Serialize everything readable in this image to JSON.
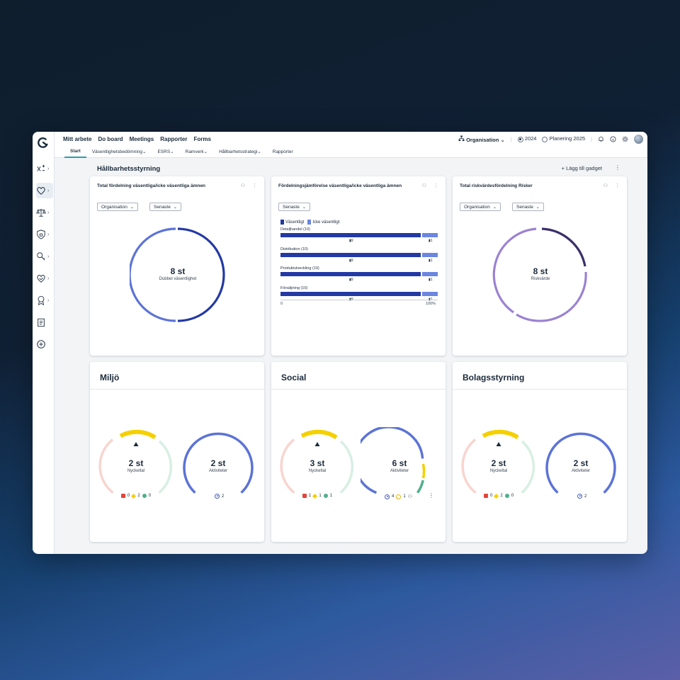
{
  "topbar": {
    "nav": [
      "Mitt arbete",
      "Do board",
      "Meetings",
      "Rapporter",
      "Forms"
    ],
    "organisation": "Organisation",
    "year": "2024",
    "planning": "Planering 2025"
  },
  "subnav": {
    "tabs": [
      "Start",
      "Väsentlighetsbedömning",
      "ESRS",
      "Ramverk",
      "Hållbarhetsstrategi",
      "Rapporter"
    ]
  },
  "leftbar": {
    "icons": [
      "scale-x-icon",
      "heart-icon",
      "balance-icon",
      "shield-lock-icon",
      "key-icon",
      "handshake-icon",
      "award-icon",
      "clipboard-icon",
      "plus-circle-icon"
    ]
  },
  "page": {
    "title": "Hållbarhetsstyrning",
    "add_gadget": "+ Lägg till gadget"
  },
  "card1": {
    "title": "Total fördelning väsentliga/icke väsentliga ämnen",
    "filter1": "Organisation",
    "filter2": "Senaste",
    "value": "8 st",
    "caption": "Dubbel väsentlighet"
  },
  "card2": {
    "title": "Fördelningsjämförelse väsentliga/icke väsentliga ämnen",
    "filter1": "Senaste",
    "legend_a": "Väsentligt",
    "legend_b": "Icke väsentligt",
    "axis_left": "0",
    "axis_right": "100%"
  },
  "card3": {
    "title": "Total riskvärdesfördelning Risker",
    "filter1": "Organisation",
    "filter2": "Senaste",
    "value": "8 st",
    "caption": "Riskvärde"
  },
  "chart_data": {
    "type": "bar",
    "categories": [
      "Detaljhandel (10)",
      "Distribution (10)",
      "Produktutveckling (10)",
      "Försäljning (10)"
    ],
    "series": [
      {
        "name": "Väsentligt",
        "values": [
          9,
          9,
          9,
          9
        ]
      },
      {
        "name": "Icke väsentligt",
        "values": [
          1,
          1,
          1,
          1
        ]
      }
    ],
    "xlim": [
      0,
      100
    ]
  },
  "categories": [
    {
      "title": "Miljö",
      "kpi_value": "2 st",
      "kpi_label": "Nyckeltal",
      "act_value": "2 st",
      "act_label": "Aktiviteter",
      "kpi_red": "0",
      "kpi_yellow": "2",
      "kpi_green": "0",
      "act_count": "2"
    },
    {
      "title": "Social",
      "kpi_value": "3 st",
      "kpi_label": "Nyckeltal",
      "act_value": "6 st",
      "act_label": "Aktiviteter",
      "kpi_red": "1",
      "kpi_yellow": "1",
      "kpi_green": "1",
      "act_count": "4",
      "act_warn": "1"
    },
    {
      "title": "Bolagsstyrning",
      "kpi_value": "2 st",
      "kpi_label": "Nyckeltal",
      "act_value": "2 st",
      "act_label": "Aktiviteter",
      "kpi_red": "0",
      "kpi_yellow": "2",
      "kpi_green": "0",
      "act_count": "2"
    }
  ],
  "colors": {
    "dark_blue": "#2339a3",
    "mid_blue": "#5c73d6",
    "purple": "#9b82d2",
    "dark_purple": "#3b2f6b",
    "yellow": "#f5d000",
    "red": "#e2453a",
    "green": "#4fb08a",
    "teal_accent": "#2e9ea8"
  }
}
